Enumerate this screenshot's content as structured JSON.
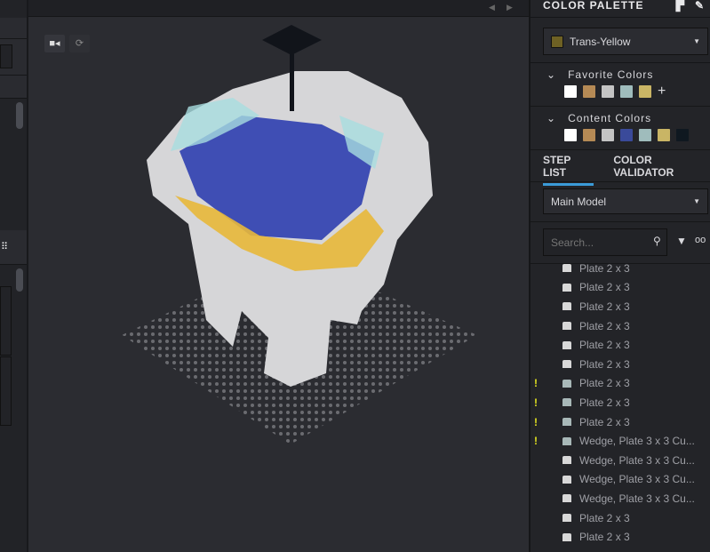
{
  "palette": {
    "title": "COLOR PALETTE",
    "selected": "Trans-Yellow",
    "selected_color": "#6e6124",
    "favorites_label": "Favorite Colors",
    "favorites": [
      "#ffffff",
      "#b58a55",
      "#c4c4c4",
      "#9fbcbc",
      "#c9b565"
    ],
    "content_label": "Content Colors",
    "content": [
      "#ffffff",
      "#b58a55",
      "#c4c4c4",
      "#3a4a9a",
      "#9fbcbc",
      "#c9b565",
      "#0f1820"
    ]
  },
  "tabs": {
    "step_list": "STEP LIST",
    "color_validator": "COLOR VALIDATOR"
  },
  "model_select": "Main Model",
  "search": {
    "placeholder": "Search..."
  },
  "steps": [
    {
      "label": "Plate 2 x 3",
      "warn": false,
      "trans": false
    },
    {
      "label": "Plate 2 x 3",
      "warn": false,
      "trans": false
    },
    {
      "label": "Plate 2 x 3",
      "warn": false,
      "trans": false
    },
    {
      "label": "Plate 2 x 3",
      "warn": false,
      "trans": false
    },
    {
      "label": "Plate 2 x 3",
      "warn": false,
      "trans": false
    },
    {
      "label": "Plate 2 x 3",
      "warn": false,
      "trans": false
    },
    {
      "label": "Plate 2 x 3",
      "warn": true,
      "trans": true
    },
    {
      "label": "Plate 2 x 3",
      "warn": true,
      "trans": true
    },
    {
      "label": "Plate 2 x 3",
      "warn": true,
      "trans": true
    },
    {
      "label": "Wedge, Plate 3 x 3 Cu...",
      "warn": true,
      "trans": true
    },
    {
      "label": "Wedge, Plate 3 x 3 Cu...",
      "warn": false,
      "trans": false
    },
    {
      "label": "Wedge, Plate 3 x 3 Cu...",
      "warn": false,
      "trans": false
    },
    {
      "label": "Wedge, Plate 3 x 3 Cu...",
      "warn": false,
      "trans": false
    },
    {
      "label": "Plate 2 x 3",
      "warn": false,
      "trans": false
    },
    {
      "label": "Plate 2 x 3",
      "warn": false,
      "trans": false
    }
  ],
  "warn_mark": "!"
}
